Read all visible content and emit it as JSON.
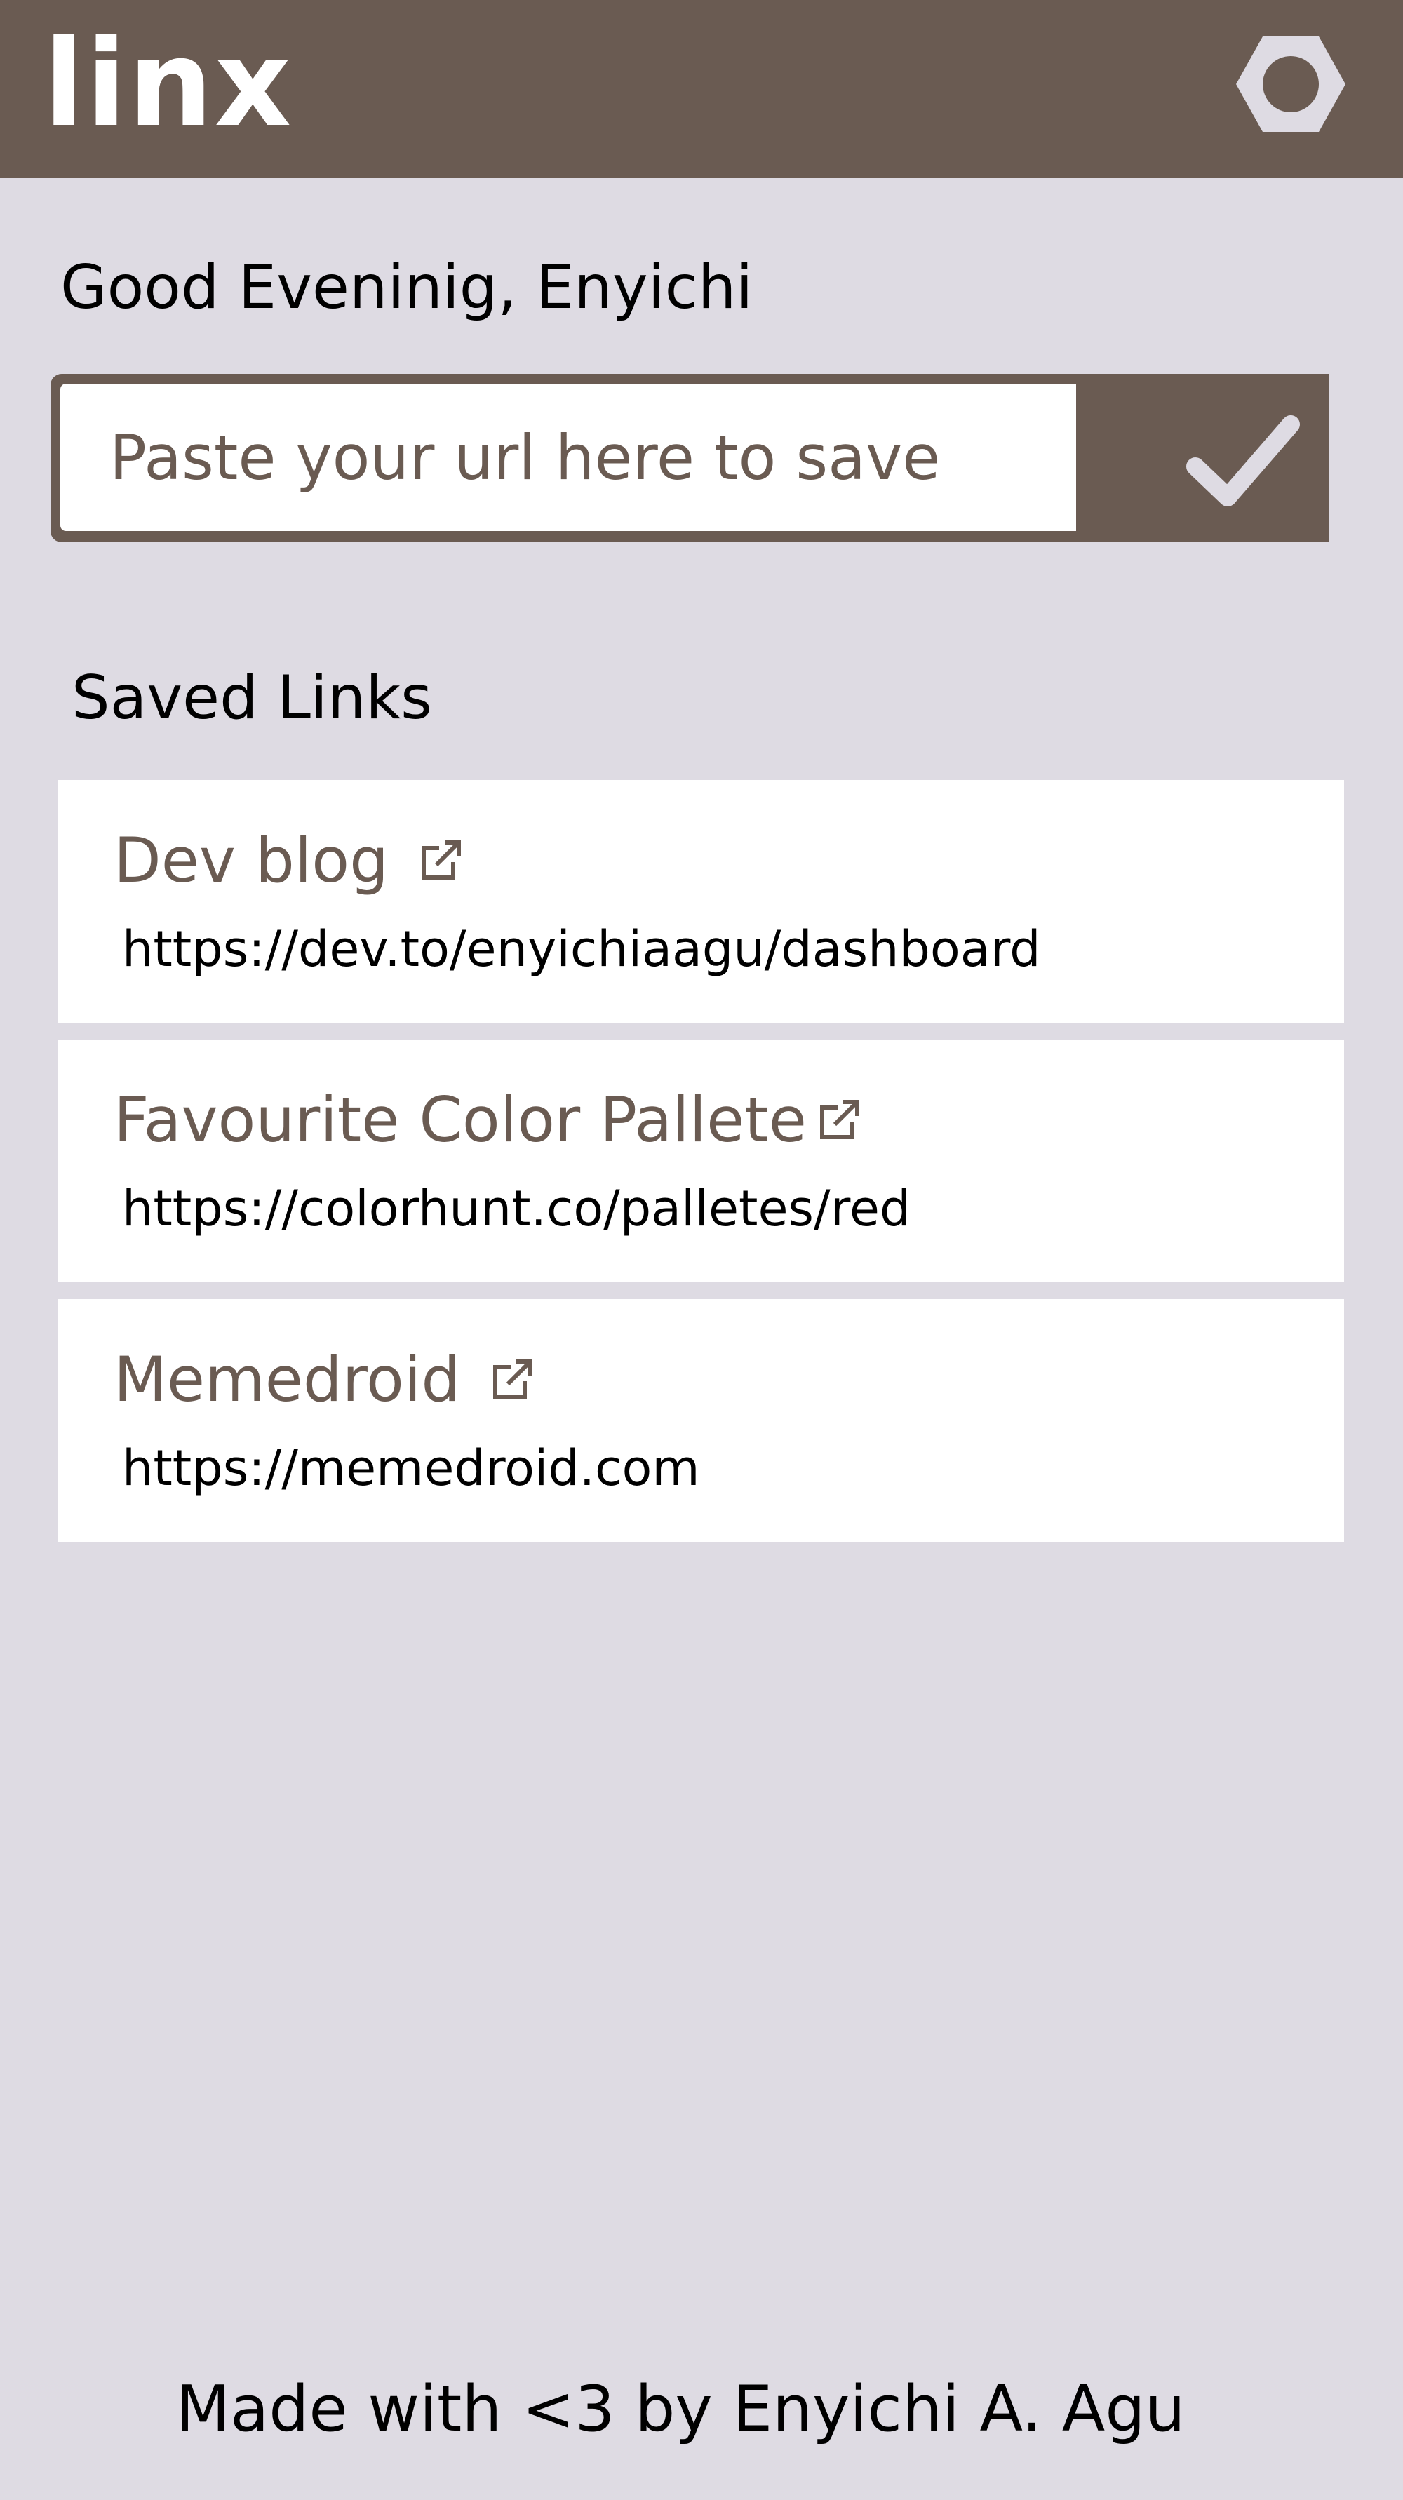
{
  "app": {
    "logo": "linx",
    "settings_icon": "hexagon-settings-icon"
  },
  "greeting": "Good Eveninig, Enyichi",
  "url_form": {
    "placeholder": "Paste your url here to save",
    "value": "",
    "submit_icon": "checkmark-icon"
  },
  "saved_links": {
    "title": "Saved Links",
    "items": [
      {
        "title": "Dev blog",
        "url": "https://dev.to/enyichiaagu/dashboard",
        "icon": "external-link-icon"
      },
      {
        "title": "Favourite Color Pallete",
        "url": "https://colorhunt.co/palletes/red",
        "icon": "external-link-icon"
      },
      {
        "title": "Memedroid",
        "url": "https://memedroid.com",
        "icon": "external-link-icon"
      }
    ]
  },
  "footer": "Made with <3 by Enyichi A. Agu",
  "colors": {
    "primary": "#6a5b52",
    "background": "#dedbe3",
    "card": "#ffffff",
    "text": "#000000"
  }
}
